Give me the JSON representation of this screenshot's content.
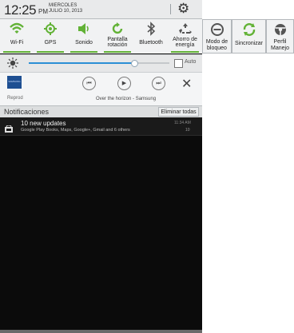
{
  "status": {
    "time": "12:25",
    "ampm": "PM",
    "day": "MIERCOLES",
    "date": "JULIO 10, 2013"
  },
  "quick": [
    {
      "label": "Wi-Fi",
      "icon": "wifi-icon",
      "active": true
    },
    {
      "label": "GPS",
      "icon": "gps-icon",
      "active": true
    },
    {
      "label": "Sonido",
      "icon": "sound-icon",
      "active": true
    },
    {
      "label": "Pantalla rotación",
      "icon": "rotation-icon",
      "active": true
    },
    {
      "label": "Bluetooth",
      "icon": "bluetooth-icon",
      "active": false
    },
    {
      "label": "Ahorro de energía",
      "icon": "power-saving-icon",
      "active": true
    }
  ],
  "extra": [
    {
      "label": "Modo de bloqueo",
      "icon": "blocking-mode-icon"
    },
    {
      "label": "Sincronizar",
      "icon": "sync-icon"
    },
    {
      "label": "Perfil Manejo",
      "icon": "driving-mode-icon"
    }
  ],
  "brightness": {
    "level": 0.75,
    "auto_label": "Auto"
  },
  "media": {
    "reprod": "Reprod",
    "song": "Over the horizon - Samsung",
    "thumb": "SAMSUNG"
  },
  "notifications": {
    "header": "Notificaciones",
    "clear": "Eliminar todas"
  },
  "notif": {
    "title": "10 new updates",
    "subtitle": "Google Play Books, Maps, Google+, Gmail and 6 others",
    "time": "11:34 AM",
    "count": "10"
  },
  "colors": {
    "accent_green": "#62b236",
    "slider_blue": "#2b8fd5"
  }
}
